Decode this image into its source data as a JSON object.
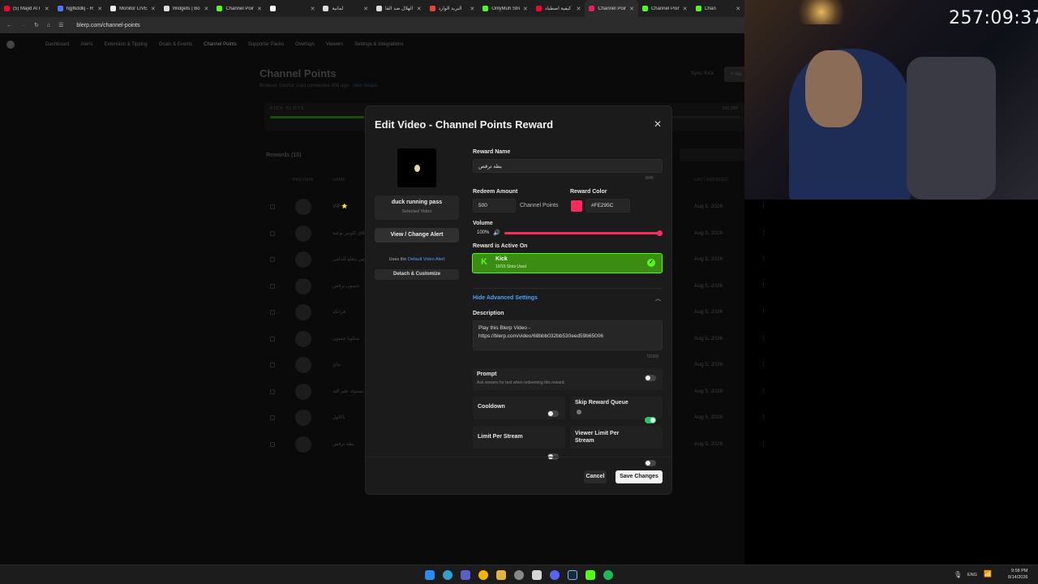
{
  "tabs": [
    {
      "label": "(5) Majid Al I",
      "color": "#ff0033"
    },
    {
      "label": "hgjfkddkj - R",
      "color": "#4a7bf7"
    },
    {
      "label": "Monitor LIVE",
      "color": "#eeeeee"
    },
    {
      "label": "Widgets | Bo",
      "color": "#dddddd"
    },
    {
      "label": "Channel Poin",
      "color": "#53fc18"
    },
    {
      "label": "",
      "color": "#ffffff"
    },
    {
      "label": "لمانية",
      "color": "#dddddd"
    },
    {
      "label": "الهلال ضد الفا",
      "color": "#dddddd"
    },
    {
      "label": "البريد الوارد",
      "color": "#ea4335"
    },
    {
      "label": "OnlyMuh Stre",
      "color": "#53fc18"
    },
    {
      "label": "كيفية اصطياد",
      "color": "#ff0033"
    },
    {
      "label": "Channel Poin",
      "color": "#e91e63",
      "active": true
    },
    {
      "label": "Channel Poin",
      "color": "#53fc18"
    },
    {
      "label": "Chan",
      "color": "#53fc18"
    }
  ],
  "browser": {
    "url": "blerp.com/channel-points"
  },
  "timer": "257:09:37",
  "nav": [
    "Dashboard",
    "Alerts",
    "Extension & Tipping",
    "Goals & Events",
    "Channel Points",
    "Supporter Packs",
    "Overlays",
    "Viewers",
    "Settings & Integrations"
  ],
  "page": {
    "title": "Channel Points",
    "subtitle": "Browser Source: Last connected 30d ago",
    "subtitle_link": "view details",
    "sync": "Sync Kick",
    "new": "+ Ne",
    "slots_label": "KICK SLOTS",
    "slots_value": "100,000",
    "rewards_title": "Rewards (10)",
    "col_preview": "PREVIEW",
    "col_name": "NAME",
    "col_last": "LAST MODIFIED",
    "rows": [
      {
        "name": "VIP ⭐",
        "date": "Aug 5, 2026"
      },
      {
        "name": "اغلاق كاونتر نوعية",
        "date": "Aug 5, 2026"
      },
      {
        "name": "بروس ينقلع للدلفي",
        "date": "Aug 5, 2026"
      },
      {
        "name": "حسون يرقص",
        "date": "Aug 5, 2026"
      },
      {
        "name": "فرانكه",
        "date": "Aug 5, 2026"
      },
      {
        "name": "سكوبا جسون",
        "date": "Aug 5, 2026"
      },
      {
        "name": "نباي",
        "date": "Aug 5, 2026"
      },
      {
        "name": "تستولد علم الله",
        "date": "Aug 5, 2026"
      },
      {
        "name": "ياالاول",
        "date": "Aug 5, 2026"
      },
      {
        "name": "بطه ترقص",
        "date": "Aug 5, 2026"
      }
    ]
  },
  "modal": {
    "title": "Edit Video - Channel Points Reward",
    "video_name": "duck running pass",
    "video_sub": "Selected Video",
    "view_change": "View / Change Alert",
    "uses_prefix": "Uses the",
    "uses_link": "Default Video Alert",
    "detach": "Detach & Customize",
    "reward_name_label": "Reward Name",
    "reward_name_value": "بطه ترقص",
    "reward_name_count": "8/45",
    "redeem_label": "Redeem Amount",
    "redeem_value": "500",
    "redeem_unit": "Channel Points",
    "color_label": "Reward Color",
    "color_value": "#FE295C",
    "volume_label": "Volume",
    "volume_value": "100%",
    "volume_level": 1.0,
    "active_label": "Reward is Active On",
    "platform": "Kick",
    "platform_sub": "10/15 Slots Used",
    "advanced": "Hide Advanced Settings",
    "desc_label": "Description",
    "desc_value": "Play this Blerp Video - https://blerp.com/video/68bbb032bb530eed59b65006",
    "desc_count": "72/200",
    "prompt_label": "Prompt",
    "prompt_sub": "Ask viewers for text when redeeming this reward.",
    "cooldown": "Cooldown",
    "skip_queue": "Skip Reward Queue",
    "limit_stream": "Limit Per Stream",
    "viewer_limit": "Viewer Limit Per Stream",
    "cancel": "Cancel",
    "save": "Save Changes"
  },
  "taskbar": {
    "lang": "ENG",
    "time": "9:58 PM",
    "date": "8/14/2026"
  },
  "colors": {
    "accent_green": "#53fc18",
    "toggle_on": "#29c46a",
    "reward_color": "#fe295c",
    "link_blue": "#4aa3ff"
  }
}
